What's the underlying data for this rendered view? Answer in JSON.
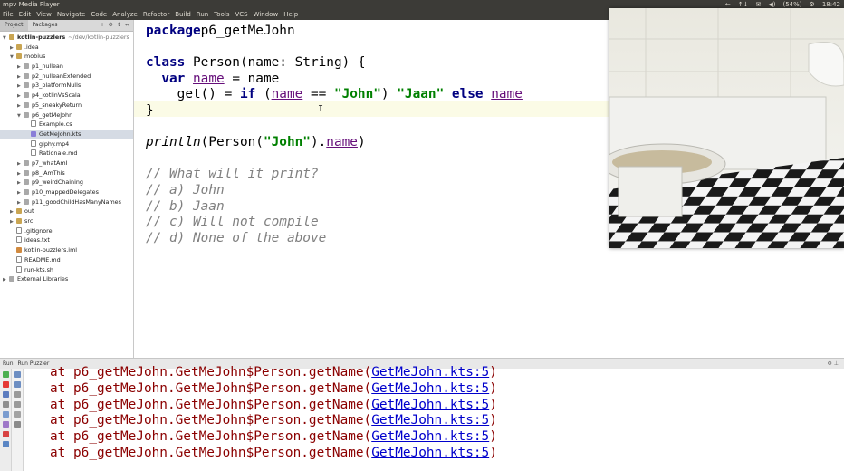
{
  "window": {
    "title": "mpv Media Player",
    "tray": [
      "←",
      "↑↓",
      "✉",
      "◀)",
      "(54%)",
      "⚙",
      "18:42"
    ]
  },
  "menu": [
    "File",
    "Edit",
    "View",
    "Navigate",
    "Code",
    "Analyze",
    "Refactor",
    "Build",
    "Run",
    "Tools",
    "VCS",
    "Window",
    "Help"
  ],
  "panel": {
    "tabs": [
      "Project",
      "Packages"
    ],
    "tools": [
      "+",
      "⚙",
      "↕",
      "↔"
    ]
  },
  "tree": [
    {
      "label": "kotlin-puzzlers",
      "path": "~/dev/kotlin-puzzlers",
      "depth": 0,
      "arrow": "▼",
      "icon": "folder",
      "bold": true
    },
    {
      "label": ".idea",
      "depth": 1,
      "arrow": "▶",
      "icon": "folder"
    },
    {
      "label": "mobius",
      "depth": 1,
      "arrow": "▼",
      "icon": "folder"
    },
    {
      "label": "p1_nullean",
      "depth": 2,
      "arrow": "▶",
      "icon": "pkg"
    },
    {
      "label": "p2_nulleanExtended",
      "depth": 2,
      "arrow": "▶",
      "icon": "pkg"
    },
    {
      "label": "p3_platformNulls",
      "depth": 2,
      "arrow": "▶",
      "icon": "pkg"
    },
    {
      "label": "p4_kotlinVsScala",
      "depth": 2,
      "arrow": "▶",
      "icon": "pkg"
    },
    {
      "label": "p5_sneakyReturn",
      "depth": 2,
      "arrow": "▶",
      "icon": "pkg"
    },
    {
      "label": "p6_getMeJohn",
      "depth": 2,
      "arrow": "▼",
      "icon": "pkg"
    },
    {
      "label": "Example.cs",
      "depth": 3,
      "arrow": "",
      "icon": "file"
    },
    {
      "label": "GetMeJohn.kts",
      "depth": 3,
      "arrow": "",
      "icon": "kts",
      "selected": true
    },
    {
      "label": "giphy.mp4",
      "depth": 3,
      "arrow": "",
      "icon": "file"
    },
    {
      "label": "Rationale.md",
      "depth": 3,
      "arrow": "",
      "icon": "file"
    },
    {
      "label": "p7_whatAmI",
      "depth": 2,
      "arrow": "▶",
      "icon": "pkg"
    },
    {
      "label": "p8_iAmThis",
      "depth": 2,
      "arrow": "▶",
      "icon": "pkg"
    },
    {
      "label": "p9_weirdChaining",
      "depth": 2,
      "arrow": "▶",
      "icon": "pkg"
    },
    {
      "label": "p10_mappedDelegates",
      "depth": 2,
      "arrow": "▶",
      "icon": "pkg"
    },
    {
      "label": "p11_goodChildHasManyNames",
      "depth": 2,
      "arrow": "▶",
      "icon": "pkg"
    },
    {
      "label": "out",
      "depth": 1,
      "arrow": "▶",
      "icon": "folder"
    },
    {
      "label": "src",
      "depth": 1,
      "arrow": "▶",
      "icon": "folder"
    },
    {
      "label": ".gitignore",
      "depth": 1,
      "arrow": "",
      "icon": "file"
    },
    {
      "label": "ideas.txt",
      "depth": 1,
      "arrow": "",
      "icon": "file"
    },
    {
      "label": "kotlin-puzzlers.iml",
      "depth": 1,
      "arrow": "",
      "icon": "mod"
    },
    {
      "label": "README.md",
      "depth": 1,
      "arrow": "",
      "icon": "file"
    },
    {
      "label": "run-kts.sh",
      "depth": 1,
      "arrow": "",
      "icon": "file"
    },
    {
      "label": "External Libraries",
      "depth": 0,
      "arrow": "▶",
      "icon": "pkg"
    }
  ],
  "code": [
    [
      [
        "kw",
        "package"
      ],
      [
        "",
        "p6_getMeJohn"
      ]
    ],
    [],
    [
      [
        "kw",
        "class"
      ],
      [
        "",
        " Person(name: String) {"
      ]
    ],
    [
      [
        "",
        "  "
      ],
      [
        "kw",
        "var"
      ],
      [
        "",
        " "
      ],
      [
        "prop",
        "name"
      ],
      [
        "",
        " = name"
      ]
    ],
    [
      [
        "",
        "    get() = "
      ],
      [
        "kw",
        "if"
      ],
      [
        "",
        " ("
      ],
      [
        "prop",
        "name"
      ],
      [
        "",
        " == "
      ],
      [
        "str",
        "\"John\""
      ],
      [
        "",
        ") "
      ],
      [
        "str",
        "\"Jaan\""
      ],
      [
        "",
        " "
      ],
      [
        "kw",
        "else"
      ],
      [
        "",
        " "
      ],
      [
        "prop",
        "name"
      ]
    ],
    [
      [
        "",
        "}"
      ]
    ],
    [],
    [
      [
        "fn",
        "println"
      ],
      [
        "",
        "(Person("
      ],
      [
        "str",
        "\"John\""
      ],
      [
        "",
        ")."
      ],
      [
        "prop",
        "name"
      ],
      [
        "",
        ")"
      ]
    ],
    [],
    [
      [
        "cmt",
        "// What will it print?"
      ]
    ],
    [
      [
        "cmt",
        "// a) John"
      ]
    ],
    [
      [
        "cmt",
        "// b) Jaan"
      ]
    ],
    [
      [
        "cmt",
        "// c) Will not compile"
      ]
    ],
    [
      [
        "cmt",
        "// d) None of the above"
      ]
    ]
  ],
  "run": {
    "label": "Run",
    "config": "Run Puzzler",
    "lines": [
      {
        "prefix": "at p6_getMeJohn.GetMeJohn$Person.getName(",
        "link": "GetMeJohn.kts:5",
        "suffix": ")"
      },
      {
        "prefix": "at p6_getMeJohn.GetMeJohn$Person.getName(",
        "link": "GetMeJohn.kts:5",
        "suffix": ")"
      },
      {
        "prefix": "at p6_getMeJohn.GetMeJohn$Person.getName(",
        "link": "GetMeJohn.kts:5",
        "suffix": ")"
      },
      {
        "prefix": "at p6_getMeJohn.GetMeJohn$Person.getName(",
        "link": "GetMeJohn.kts:5",
        "suffix": ")"
      },
      {
        "prefix": "at p6_getMeJohn.GetMeJohn$Person.getName(",
        "link": "GetMeJohn.kts:5",
        "suffix": ")"
      },
      {
        "prefix": "at p6_getMeJohn.GetMeJohn$Person.getName(",
        "link": "GetMeJohn.kts:5",
        "suffix": ")"
      }
    ]
  },
  "colors": {
    "keyword": "#000080",
    "string": "#008000",
    "property": "#660e7a",
    "comment": "#808080",
    "error": "#8b0000",
    "link": "#0000cc"
  }
}
